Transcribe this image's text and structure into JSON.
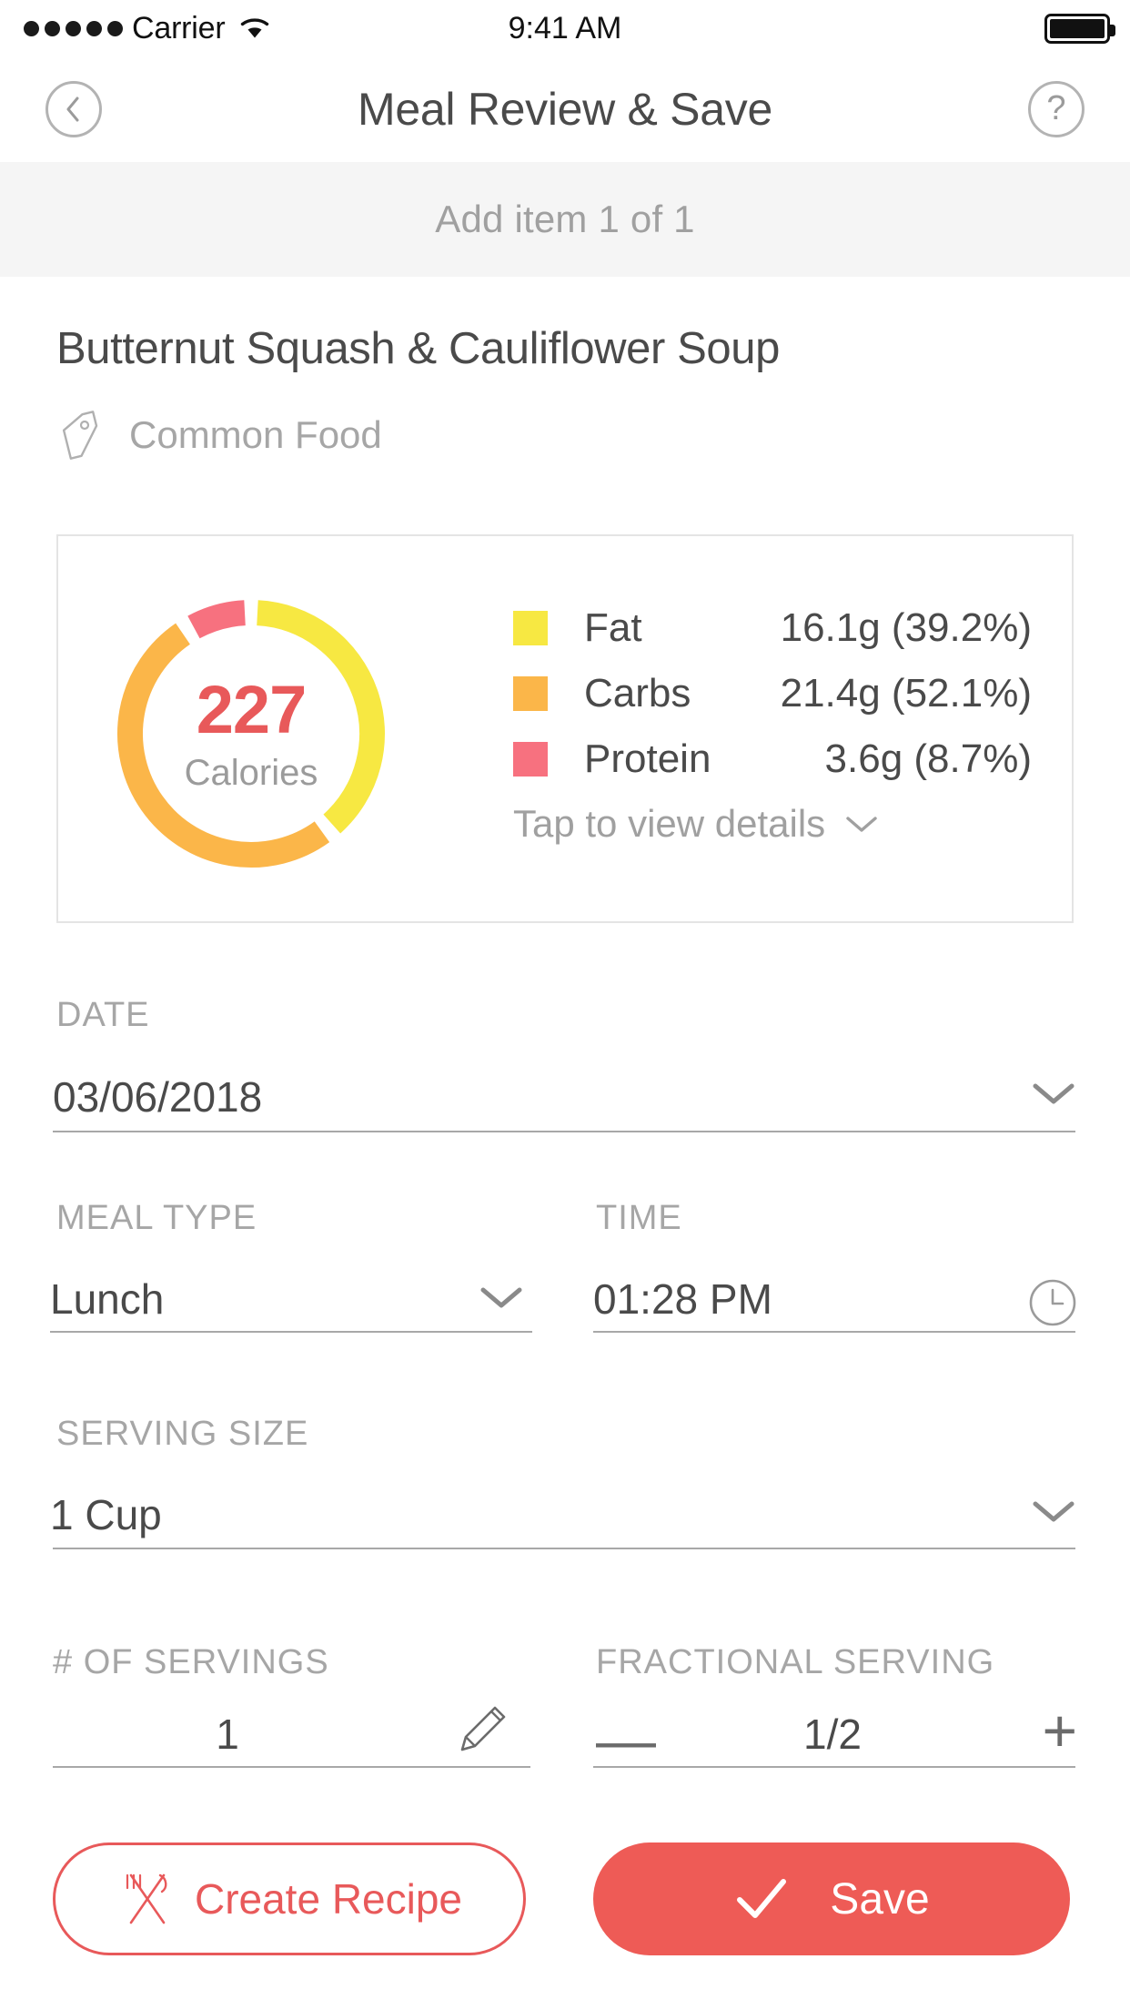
{
  "status_bar": {
    "signal_dots": 5,
    "carrier": "Carrier",
    "wifi_icon": "wifi-icon",
    "time": "9:41 AM",
    "battery_icon": "battery-full-icon"
  },
  "nav": {
    "back_icon": "chevron-left-icon",
    "title": "Meal Review & Save",
    "help_icon": "question-mark-icon",
    "help_label": "?"
  },
  "subheader": {
    "text": "Add item 1 of 1"
  },
  "food": {
    "name": "Butternut Squash & Cauliflower Soup",
    "tag_icon": "price-tag-icon",
    "tag_label": "Common Food"
  },
  "nutrition": {
    "calories": "227",
    "calories_label": "Calories",
    "tap_details_label": "Tap to view details",
    "tap_details_icon": "chevron-down-icon",
    "legend": [
      {
        "name": "Fat",
        "value": "16.1g (39.2%)",
        "color": "#F7E842"
      },
      {
        "name": "Carbs",
        "value": "21.4g (52.1%)",
        "color": "#FBB649"
      },
      {
        "name": "Protein",
        "value": "3.6g (8.7%)",
        "color": "#F7717F"
      }
    ]
  },
  "chart_data": {
    "type": "pie",
    "title": "Macronutrient breakdown",
    "center_value": 227,
    "center_label": "Calories",
    "categories": [
      "Fat",
      "Carbs",
      "Protein"
    ],
    "values": [
      39.2,
      52.1,
      8.7
    ],
    "grams": [
      16.1,
      21.4,
      3.6
    ],
    "units": "percent of calories",
    "colors": [
      "#F7E842",
      "#FBB649",
      "#F7717F"
    ],
    "legend": "right",
    "donut": true,
    "start_angle_deg": 0,
    "gap_deg": 6
  },
  "form": {
    "date": {
      "label": "DATE",
      "value": "03/06/2018",
      "icon": "chevron-down-icon"
    },
    "meal_type": {
      "label": "MEAL TYPE",
      "value": "Lunch",
      "icon": "chevron-down-icon"
    },
    "time": {
      "label": "TIME",
      "value": "01:28 PM",
      "icon": "clock-icon"
    },
    "serving_size": {
      "label": "SERVING SIZE",
      "value": "1 Cup",
      "icon": "chevron-down-icon"
    },
    "num_servings": {
      "label": "# OF SERVINGS",
      "value": "1",
      "icon": "pencil-icon"
    },
    "fractional_serving": {
      "label": "FRACTIONAL SERVING",
      "value": "1/2",
      "minus": "—",
      "plus": "+"
    }
  },
  "actions": {
    "create_recipe": {
      "label": "Create Recipe",
      "icon": "fork-knife-icon",
      "color": "#E8595A"
    },
    "save": {
      "label": "Save",
      "icon": "check-icon",
      "color": "#EE5B56"
    }
  }
}
